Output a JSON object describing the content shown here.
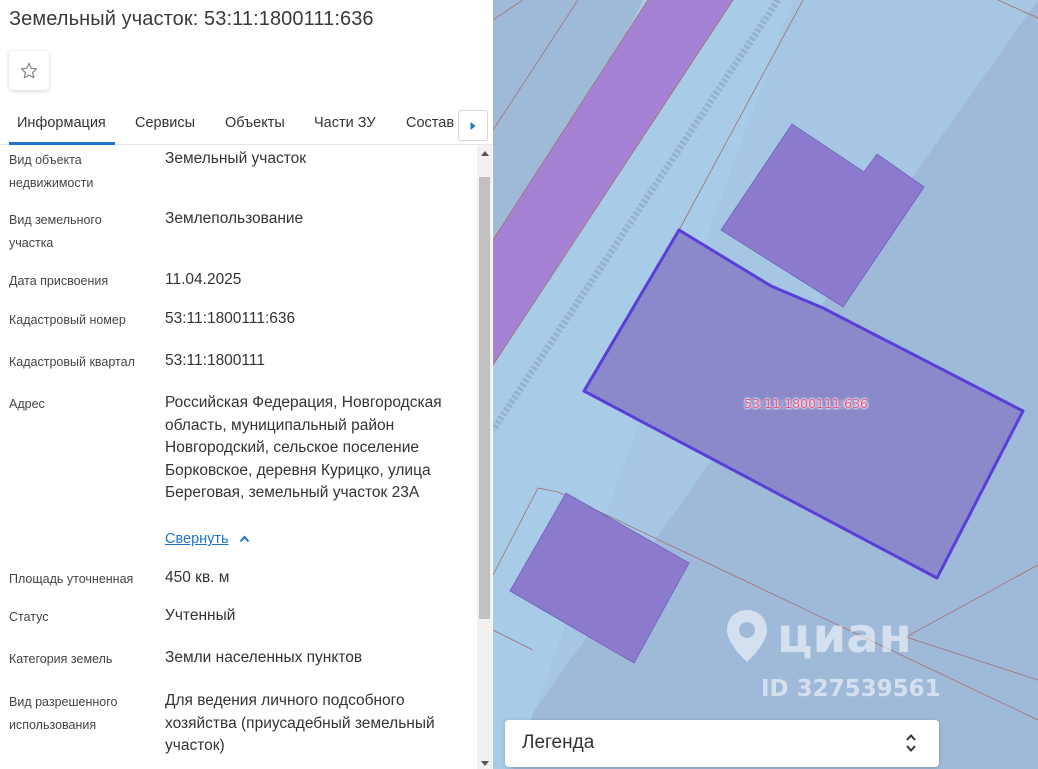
{
  "header": {
    "title": "Земельный участок: 53:11:1800111:636",
    "favorite_icon": "star-outline-icon"
  },
  "tabs": [
    {
      "label": "Информация",
      "active": true
    },
    {
      "label": "Сервисы",
      "active": false
    },
    {
      "label": "Объекты",
      "active": false
    },
    {
      "label": "Части ЗУ",
      "active": false
    },
    {
      "label": "Состав",
      "active": false
    }
  ],
  "tabs_next_icon": "caret-right-icon",
  "info": {
    "object_type": {
      "label": "Вид объекта недвижимости",
      "value": "Земельный участок"
    },
    "land_type": {
      "label": "Вид земельного участка",
      "value": "Землепользование"
    },
    "assign_date": {
      "label": "Дата присвоения",
      "value": "11.04.2025"
    },
    "cadastral_number": {
      "label": "Кадастровый номер",
      "value": "53:11:1800111:636"
    },
    "cadastral_quarter": {
      "label": "Кадастровый квартал",
      "value": "53:11:1800111"
    },
    "address": {
      "label": "Адрес",
      "value": "Российская Федерация, Новгородская область, муниципальный район Новгородский, сельское поселение Борковское, деревня Курицко, улица Береговая, земельный участок 23А"
    },
    "collapse_link": "Свернуть",
    "area": {
      "label": "Площадь уточненная",
      "value": "450 кв. м"
    },
    "status": {
      "label": "Статус",
      "value": "Учтенный"
    },
    "land_category": {
      "label": "Категория земель",
      "value": "Земли населенных пунктов"
    },
    "permitted_use": {
      "label": "Вид разрешенного использования",
      "value": "Для ведения личного подсобного хозяйства (приусадебный земельный участок)"
    }
  },
  "map": {
    "parcel_label": "53:11:1800111:636",
    "watermark_brand": "циан",
    "watermark_id": "ID 327539561",
    "legend_label": "Легенда",
    "colors": {
      "background": "#9fbad8",
      "road": "#a6c9e6",
      "parcel_fill": "#8a8acb",
      "parcel_border": "#5a3ed8",
      "neighbor_fill": "#8c7bcc",
      "accent": "#1f74c9"
    }
  }
}
